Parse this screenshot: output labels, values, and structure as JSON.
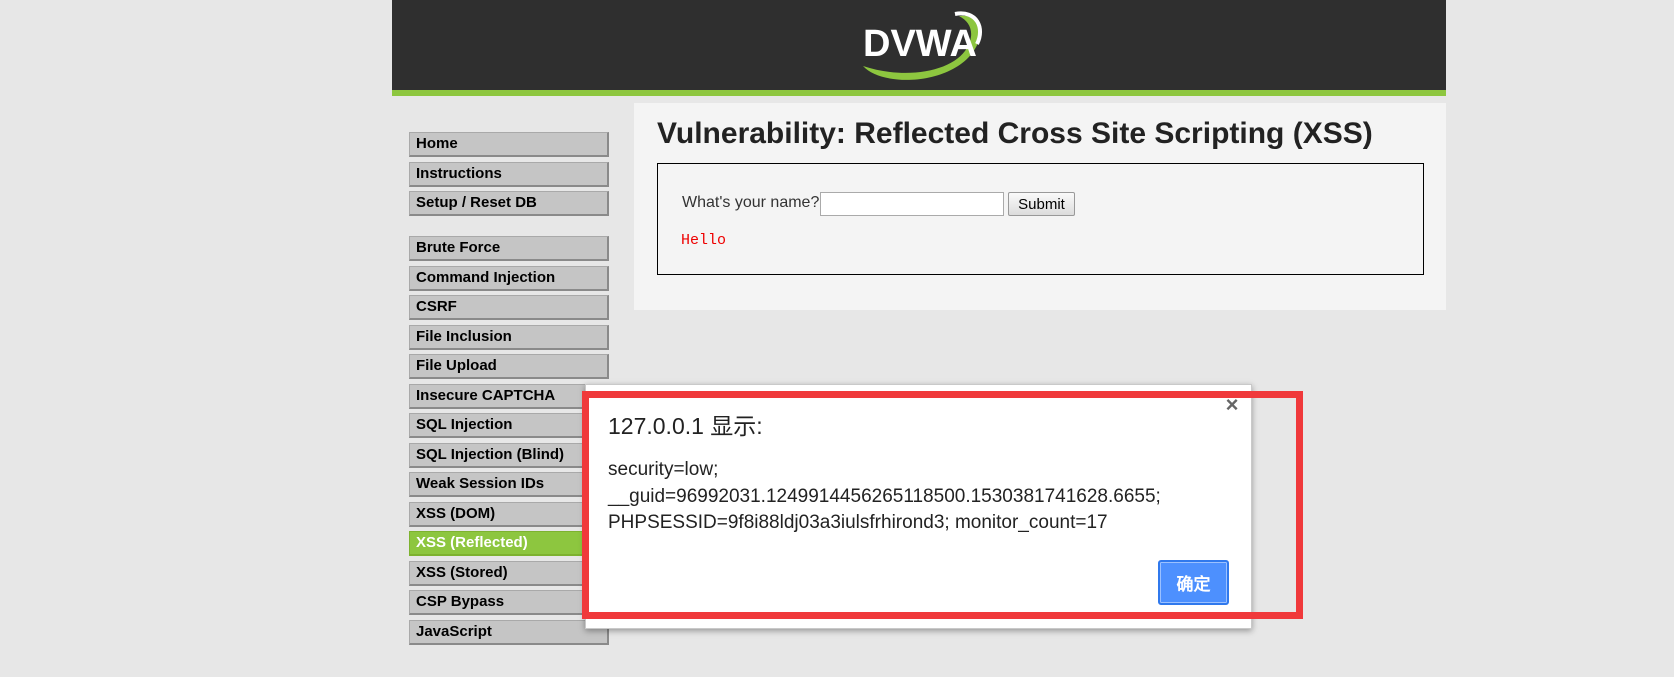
{
  "header": {
    "logo_text": "DVWA"
  },
  "menu": {
    "block1": [
      {
        "label": "Home"
      },
      {
        "label": "Instructions"
      },
      {
        "label": "Setup / Reset DB"
      }
    ],
    "block2": [
      {
        "label": "Brute Force"
      },
      {
        "label": "Command Injection"
      },
      {
        "label": "CSRF"
      },
      {
        "label": "File Inclusion"
      },
      {
        "label": "File Upload"
      },
      {
        "label": "Insecure CAPTCHA"
      },
      {
        "label": "SQL Injection"
      },
      {
        "label": "SQL Injection (Blind)"
      },
      {
        "label": "Weak Session IDs"
      },
      {
        "label": "XSS (DOM)"
      },
      {
        "label": "XSS (Reflected)",
        "selected": true
      },
      {
        "label": "XSS (Stored)"
      },
      {
        "label": "CSP Bypass"
      },
      {
        "label": "JavaScript"
      }
    ]
  },
  "main": {
    "title": "Vulnerability: Reflected Cross Site Scripting (XSS)",
    "form": {
      "label": "What's your name?",
      "input_value": "",
      "submit_label": "Submit"
    },
    "output": "Hello"
  },
  "dialog": {
    "title": "127.0.0.1 显示:",
    "message_lines": [
      "security=low;",
      "__guid=96992031.1249914456265118500.1530381741628.6655;",
      "PHPSESSID=9f8i88ldj03a3iulsfrhirond3; monitor_count=17"
    ],
    "ok_label": "确定",
    "close_glyph": "×"
  },
  "colors": {
    "header_bg": "#2f2f2f",
    "accent_green": "#8dc63f",
    "highlight_red": "#f0393b",
    "dialog_button_blue": "#4d90fe"
  }
}
